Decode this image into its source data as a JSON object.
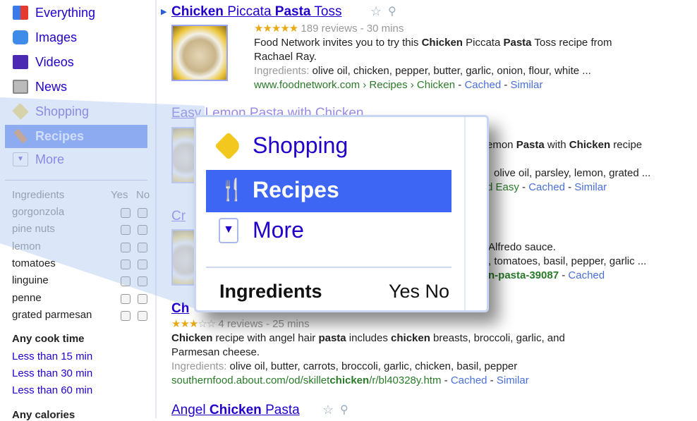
{
  "sidebar": {
    "nav": [
      {
        "label": "Everything",
        "icon": "everything-icon"
      },
      {
        "label": "Images",
        "icon": "camera-icon"
      },
      {
        "label": "Videos",
        "icon": "film-icon"
      },
      {
        "label": "News",
        "icon": "newspaper-icon"
      },
      {
        "label": "Shopping",
        "icon": "price-tag-icon"
      },
      {
        "label": "Recipes",
        "icon": "utensils-icon",
        "selected": true
      },
      {
        "label": "More",
        "icon": "chevron-down-icon"
      }
    ],
    "ingredients_header": "Ingredients",
    "yes": "Yes",
    "no": "No",
    "ingredients": [
      "gorgonzola",
      "pine nuts",
      "lemon",
      "tomatoes",
      "linguine",
      "penne",
      "grated parmesan"
    ],
    "cook_time_header": "Any cook time",
    "cook_times": [
      "Less than 15 min",
      "Less than 30 min",
      "Less than 60 min"
    ],
    "calories_header": "Any calories"
  },
  "results": [
    {
      "title_parts": [
        "Chicken",
        " Piccata ",
        "Pasta",
        " Toss"
      ],
      "rating": 5,
      "meta": "189 reviews - 30 mins",
      "snippet1_a": "Food Network invites you to try this ",
      "snippet1_b": "Chicken",
      "snippet1_c": " Piccata ",
      "snippet1_d": "Pasta",
      "snippet1_e": " Toss recipe from",
      "snippet2": "Rachael Ray.",
      "ing_label": "Ingredients:",
      "ingredients": " olive oil, chicken, pepper, butter, garlic, onion, flour, white ...",
      "url": "www.foodnetwork.com › Recipes › Chicken",
      "cached": "Cached",
      "similar": "Similar"
    },
    {
      "title": "Easy Lemon Pasta with Chicken",
      "snippet_a": "emon ",
      "snippet_b": "Pasta",
      "snippet_c": " with ",
      "snippet_d": "Chicken",
      "snippet_e": " recipe",
      "ingredients": "olive oil, parsley, lemon, grated ...",
      "url": "d Easy",
      "cached": "Cached",
      "similar": "Similar"
    },
    {
      "title": "Cr",
      "snippet": "Alfredo sauce.",
      "ingredients": ", tomatoes, basil, pepper, garlic ...",
      "url": "n-pasta-39087",
      "cached": "Cached"
    },
    {
      "title": "Ch",
      "rating": 3,
      "meta": "4 reviews - 25 mins",
      "snippet1_a": "Chicken",
      "snippet1_b": " recipe with angel hair ",
      "snippet1_c": "pasta",
      "snippet1_d": " includes ",
      "snippet1_e": "chicken",
      "snippet1_f": " breasts, broccoli, garlic, and",
      "snippet2": "Parmesan cheese.",
      "ing_label": "Ingredients:",
      "ingredients": " olive oil, butter, carrots, broccoli, garlic, chicken, basil, pepper",
      "url_a": "southernfood.about.com/od/skillet",
      "url_b": "chicken",
      "url_c": "/r/bl40328y.htm",
      "cached": "Cached",
      "similar": "Similar"
    },
    {
      "title_a": "Angel ",
      "title_b": "Chicken",
      "title_c": " Pasta"
    }
  ],
  "callout": {
    "shopping": "Shopping",
    "recipes": "Recipes",
    "more": "More",
    "ingredients": "Ingredients",
    "yes_no": "Yes No"
  },
  "colors": {
    "link": "#2200cc",
    "highlight": "#3d66f5",
    "url": "#2a7a2a",
    "star": "#e8a917"
  }
}
